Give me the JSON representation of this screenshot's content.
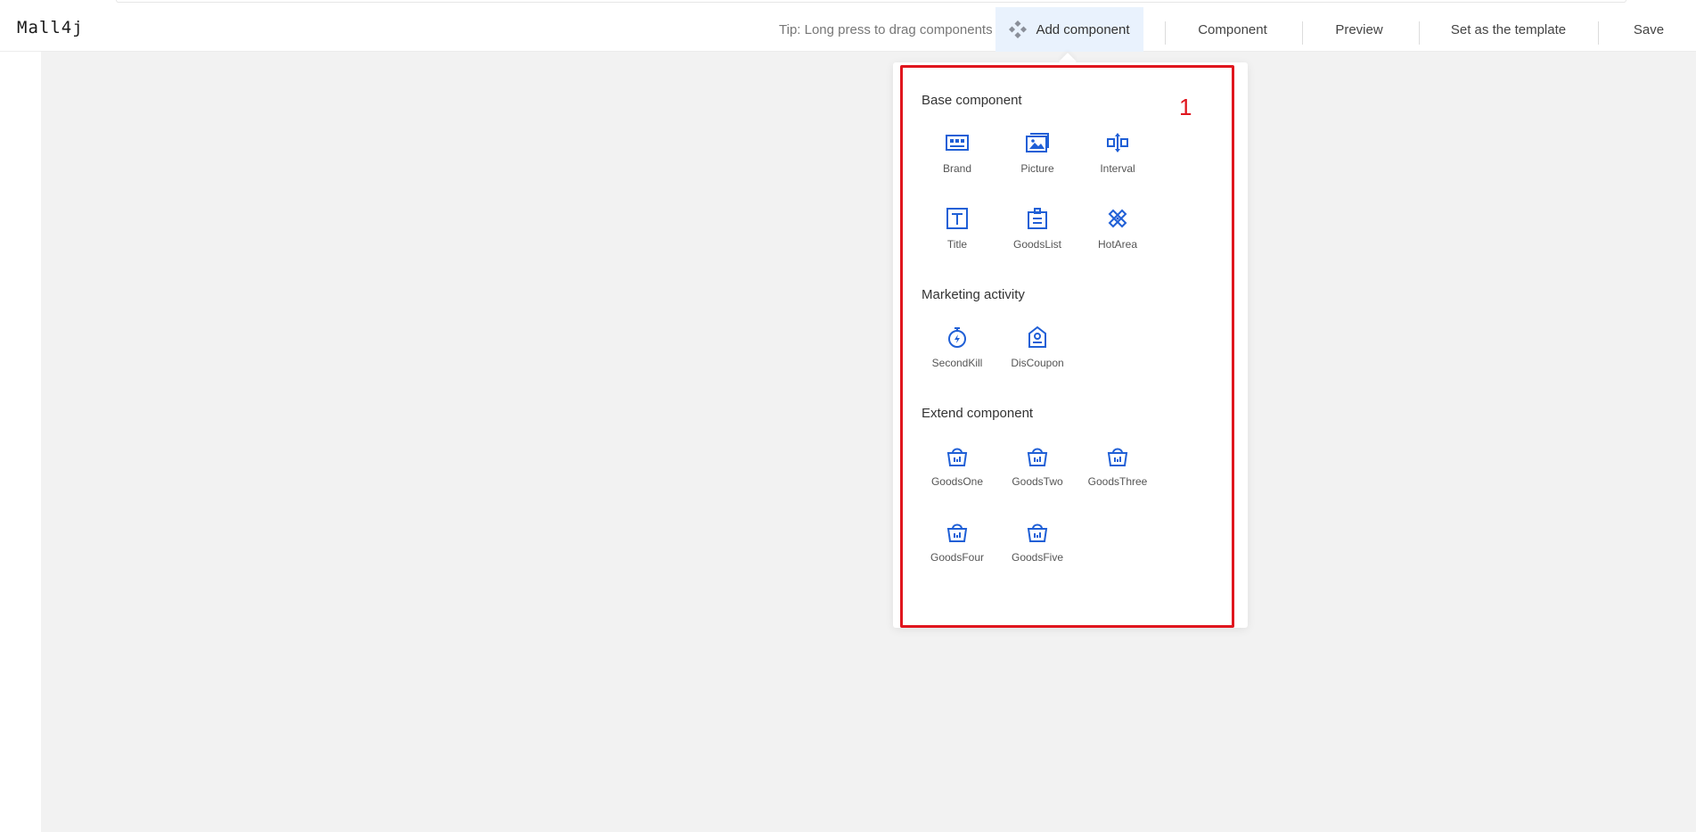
{
  "app": {
    "logo_text": "Mall4j"
  },
  "header": {
    "tip": "Tip: Long press to drag components",
    "add_component": "Add component",
    "component": "Component",
    "preview": "Preview",
    "set_template": "Set as the template",
    "save": "Save"
  },
  "popover": {
    "step_number": "1",
    "sections": [
      {
        "title": "Base component",
        "items": [
          {
            "label": "Brand",
            "icon": "brand-icon"
          },
          {
            "label": "Picture",
            "icon": "picture-icon"
          },
          {
            "label": "Interval",
            "icon": "interval-icon"
          },
          {
            "label": "Title",
            "icon": "title-icon"
          },
          {
            "label": "GoodsList",
            "icon": "goods-list-icon"
          },
          {
            "label": "HotArea",
            "icon": "hot-area-icon"
          }
        ]
      },
      {
        "title": "Marketing activity",
        "items": [
          {
            "label": "SecondKill",
            "icon": "stopwatch-icon"
          },
          {
            "label": "DisCoupon",
            "icon": "coupon-icon"
          }
        ]
      },
      {
        "title": "Extend component",
        "items": [
          {
            "label": "GoodsOne",
            "icon": "basket-icon"
          },
          {
            "label": "GoodsTwo",
            "icon": "basket-icon"
          },
          {
            "label": "GoodsThree",
            "icon": "basket-icon"
          },
          {
            "label": "GoodsFour",
            "icon": "basket-icon"
          },
          {
            "label": "GoodsFive",
            "icon": "basket-icon"
          }
        ]
      }
    ]
  },
  "colors": {
    "accent": "#1f5fd6",
    "highlight": "#e0161e",
    "canvas": "#f2f2f2",
    "active_nav": "#e9f2fd"
  }
}
